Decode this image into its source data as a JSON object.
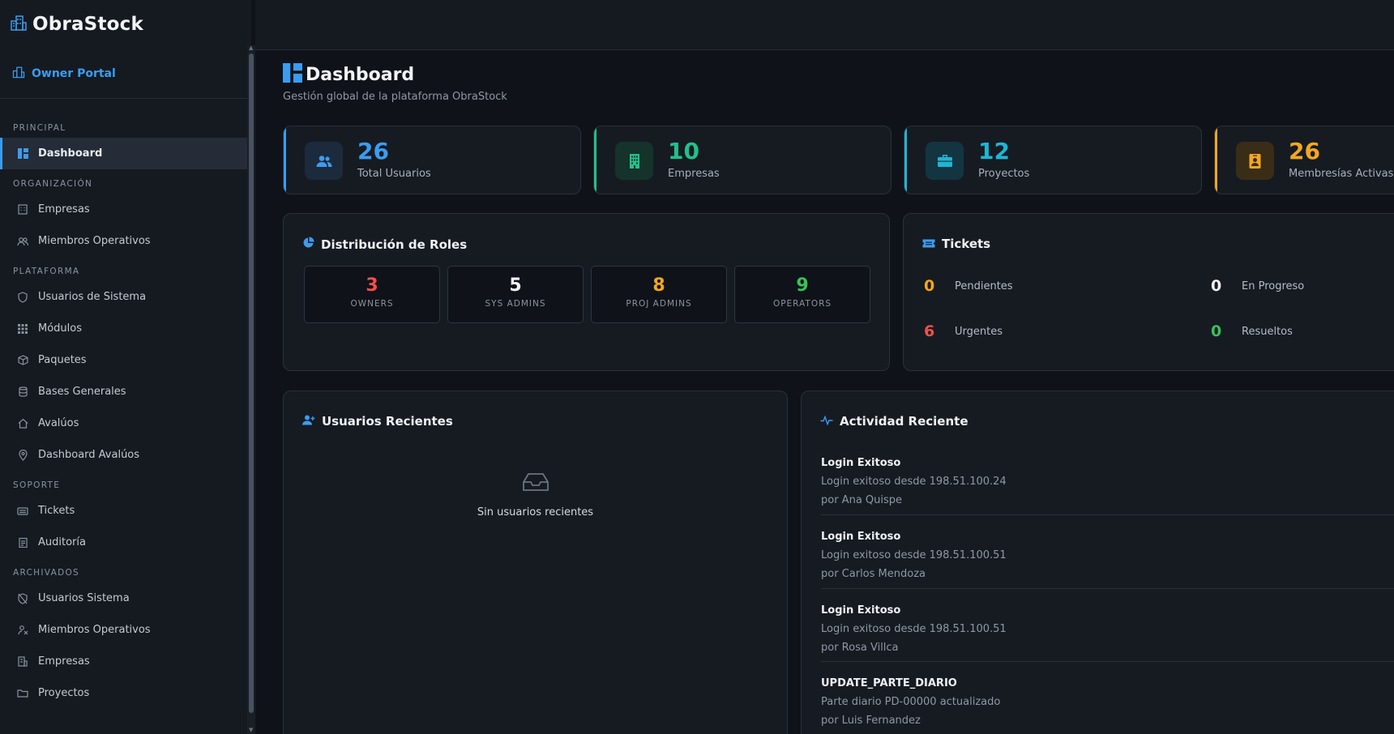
{
  "app": {
    "name": "ObraStock"
  },
  "sidebar": {
    "portal_label": "Owner Portal",
    "sections": [
      {
        "label": "PRINCIPAL",
        "items": [
          {
            "label": "Dashboard",
            "icon": "dashboard-icon",
            "active": true
          }
        ]
      },
      {
        "label": "ORGANIZACIÓN",
        "items": [
          {
            "label": "Empresas",
            "icon": "building-icon"
          },
          {
            "label": "Miembros Operativos",
            "icon": "users-icon"
          }
        ]
      },
      {
        "label": "PLATAFORMA",
        "items": [
          {
            "label": "Usuarios de Sistema",
            "icon": "shield-icon"
          },
          {
            "label": "Módulos",
            "icon": "grid-icon"
          },
          {
            "label": "Paquetes",
            "icon": "box-icon"
          },
          {
            "label": "Bases Generales",
            "icon": "database-icon"
          },
          {
            "label": "Avalúos",
            "icon": "house-icon"
          },
          {
            "label": "Dashboard Avalúos",
            "icon": "pin-icon"
          }
        ]
      },
      {
        "label": "SOPORTE",
        "items": [
          {
            "label": "Tickets",
            "icon": "ticket-icon"
          },
          {
            "label": "Auditoría",
            "icon": "clipboard-icon"
          }
        ]
      },
      {
        "label": "ARCHIVADOS",
        "items": [
          {
            "label": "Usuarios Sistema",
            "icon": "shield-off-icon"
          },
          {
            "label": "Miembros Operativos",
            "icon": "user-off-icon"
          },
          {
            "label": "Empresas",
            "icon": "building-off-icon"
          },
          {
            "label": "Proyectos",
            "icon": "folder-icon"
          }
        ]
      }
    ]
  },
  "header": {
    "title": "Dashboard",
    "subtitle": "Gestión global de la plataforma ObraStock"
  },
  "stats": [
    {
      "value": "26",
      "label": "Total Usuarios",
      "color": "#3b9cf0",
      "icon": "users-icon"
    },
    {
      "value": "10",
      "label": "Empresas",
      "color": "#22c08a",
      "icon": "building-icon"
    },
    {
      "value": "12",
      "label": "Proyectos",
      "color": "#1fb5d4",
      "icon": "briefcase-icon"
    },
    {
      "value": "26",
      "label": "Membresías Activas",
      "color": "#f2a623",
      "icon": "id-badge-icon"
    }
  ],
  "roles": {
    "title": "Distribución de Roles",
    "items": [
      {
        "value": "3",
        "label": "OWNERS",
        "color": "#f0504a"
      },
      {
        "value": "5",
        "label": "SYS ADMINS",
        "color": "#f2f4f7"
      },
      {
        "value": "8",
        "label": "PROJ ADMINS",
        "color": "#f2a623"
      },
      {
        "value": "9",
        "label": "OPERATORS",
        "color": "#39c25a"
      }
    ]
  },
  "tickets": {
    "title": "Tickets",
    "items": [
      {
        "value": "0",
        "label": "Pendientes",
        "color": "#f2a623"
      },
      {
        "value": "0",
        "label": "En Progreso",
        "color": "#f2f4f7"
      },
      {
        "value": "6",
        "label": "Urgentes",
        "color": "#f0504a"
      },
      {
        "value": "0",
        "label": "Resueltos",
        "color": "#39c25a"
      }
    ]
  },
  "recent_users": {
    "title": "Usuarios Recientes",
    "empty_text": "Sin usuarios recientes"
  },
  "activity": {
    "title": "Actividad Reciente",
    "items": [
      {
        "title": "Login Exitoso",
        "desc": "Login exitoso desde 198.51.100.24",
        "by": "por Ana Quispe"
      },
      {
        "title": "Login Exitoso",
        "desc": "Login exitoso desde 198.51.100.51",
        "by": "por Carlos Mendoza"
      },
      {
        "title": "Login Exitoso",
        "desc": "Login exitoso desde 198.51.100.51",
        "by": "por Rosa Villca"
      },
      {
        "title": "UPDATE_PARTE_DIARIO",
        "desc": "Parte diario PD-00000 actualizado",
        "by": "por Luis Fernandez"
      }
    ]
  }
}
